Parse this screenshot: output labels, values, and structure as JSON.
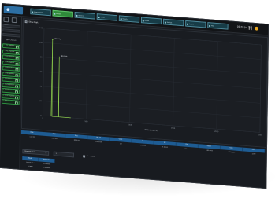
{
  "topbar": {
    "tabs": [
      {
        "label": "Measurement"
      },
      {
        "label": "Analysis"
      },
      {
        "label": "Spectrum"
      },
      {
        "label": "Trends"
      },
      {
        "label": "Reports"
      },
      {
        "label": "Events"
      },
      {
        "label": "Settings"
      },
      {
        "label": "System"
      },
      {
        "label": "Help"
      }
    ],
    "active_tab_index": 1,
    "clock": "09:33 Jul 22"
  },
  "sidebar": {
    "search_placeholder": "Search",
    "secondary_field": "",
    "header": "Signal Channels",
    "items": [
      {
        "num": "1",
        "label": "Ch-1 Amplitude"
      },
      {
        "num": "2",
        "label": "Ch-2 Amplitude"
      },
      {
        "num": "3",
        "label": "Ch-3 Amplitude"
      },
      {
        "num": "4",
        "label": "Ch-4 Amplitude"
      },
      {
        "num": "5",
        "label": "Ch-5 Amplitude"
      },
      {
        "num": "6",
        "label": "Ch-6 Amplitude"
      },
      {
        "num": "7",
        "label": "Ch-7 Amplitude"
      },
      {
        "num": "8",
        "label": "Ch-8 Amplitude"
      },
      {
        "num": "9",
        "label": "Ch-9 Amplitude"
      },
      {
        "num": "10",
        "label": "Ch-10 Amplitude"
      },
      {
        "num": "11",
        "label": "Baseline"
      }
    ]
  },
  "chart": {
    "title": "Show Peak",
    "checked": true
  },
  "chart_data": {
    "type": "line",
    "title": "Show Peak",
    "xlabel": "Frequency (Hz)",
    "ylabel": "",
    "xlim": [
      0,
      2500
    ],
    "ylim": [
      0,
      120
    ],
    "x_ticks": [
      0,
      500,
      1000,
      1500,
      2000,
      2500
    ],
    "y_ticks": [
      0,
      20,
      40,
      60,
      80,
      100,
      120
    ],
    "grid": true,
    "series": [
      {
        "values_x": [
          95,
          100,
          105,
          178,
          180,
          182,
          320,
          321
        ],
        "values_y": [
          0,
          105,
          0,
          0,
          82,
          0,
          0,
          0
        ]
      }
    ],
    "annotations": [
      {
        "x": 100,
        "y": 105,
        "text": "100.0 Hz"
      },
      {
        "x": 180,
        "y": 82,
        "text": "180.0 Hz"
      }
    ],
    "color": "#8fd04d"
  },
  "table": {
    "headers": [
      "Peak",
      "RMS",
      "Freq",
      "1X / 2X",
      "Crest",
      "1X",
      "2X",
      "Gap",
      "Factor",
      "Gain",
      "Ratio"
    ],
    "row": [
      "1.10 in/s",
      "0.42 in/s",
      "100.0 Hz",
      "0.000 in/s",
      "1.5",
      "0.30 in/s",
      "0.10 in/s",
      "0.1 mm",
      "1.82 mm/s",
      "24000 rpm",
      "2.000"
    ]
  },
  "lower": {
    "select_value": "Measured Value",
    "number_value": "1",
    "show_peaks_label": "Show Peaks",
    "subtable": {
      "headers": [
        "Mode",
        "Amplitude"
      ],
      "rows": [
        [
          "Overall Value",
          "1.03 mm/s"
        ],
        [
          "1X RMS",
          "0.48 mm/s"
        ]
      ]
    }
  },
  "colors": {
    "accent_green": "#2f8a3a",
    "table_header_blue": "#1e5c93",
    "status_orange": "#e9a722",
    "trace": "#8fd04d"
  }
}
